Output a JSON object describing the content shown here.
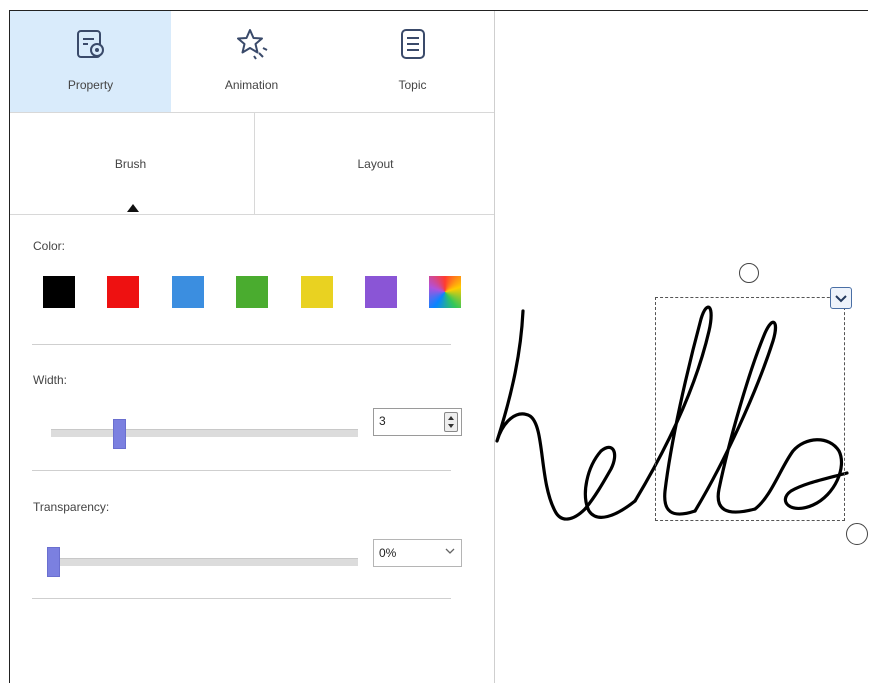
{
  "tabs": [
    {
      "label": "Property",
      "icon": "property-settings-icon",
      "active": true
    },
    {
      "label": "Animation",
      "icon": "star-animation-icon",
      "active": false
    },
    {
      "label": "Topic",
      "icon": "document-topic-icon",
      "active": false
    }
  ],
  "subtabs": [
    {
      "label": "Brush",
      "active": true
    },
    {
      "label": "Layout",
      "active": false
    }
  ],
  "color": {
    "label": "Color:",
    "swatches": [
      "#000000",
      "#ee1111",
      "#3b8ee0",
      "#4aac2f",
      "#e9d221",
      "#8a55d6",
      "gradient"
    ]
  },
  "width": {
    "label": "Width:",
    "value": "3",
    "slider_fraction": 0.22
  },
  "transparency": {
    "label": "Transparency:",
    "value": "0%",
    "slider_fraction": 0.0
  },
  "canvas": {
    "ink_text": "hello",
    "accent": "#4a6fa5"
  }
}
